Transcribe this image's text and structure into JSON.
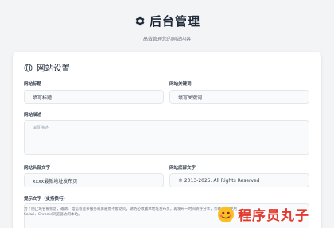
{
  "header": {
    "title": "后台管理",
    "subtitle": "高效管理您的网站内容"
  },
  "site_settings": {
    "section_title": "网站设置",
    "site_title": {
      "label": "网站标题",
      "value": "填写标题"
    },
    "site_keywords": {
      "label": "网站关键词",
      "value": "填写关键词"
    },
    "site_description": {
      "label": "网站描述",
      "placeholder": "填写描述"
    },
    "header_text": {
      "label": "网站头部文字",
      "value": "xxxx最新地址发布页"
    },
    "footer_text": {
      "label": "网站底部文字",
      "value": "© 2013-2025. All Rights Reserved"
    },
    "notice": {
      "label": "提示文字（支持换行）",
      "value": "为了防止域名被拐走，邀请、电信等宽带服务商屏蔽而不能访问，请务必收藏本地址发布页，再发布一时间转存分享，亲转 尽量使用Safari、Chrome浏览器访问本站。"
    }
  },
  "watermark": {
    "text": "程序员丸子"
  },
  "colors": {
    "accent": "#e23a2f",
    "background": "#f3f4f6"
  }
}
